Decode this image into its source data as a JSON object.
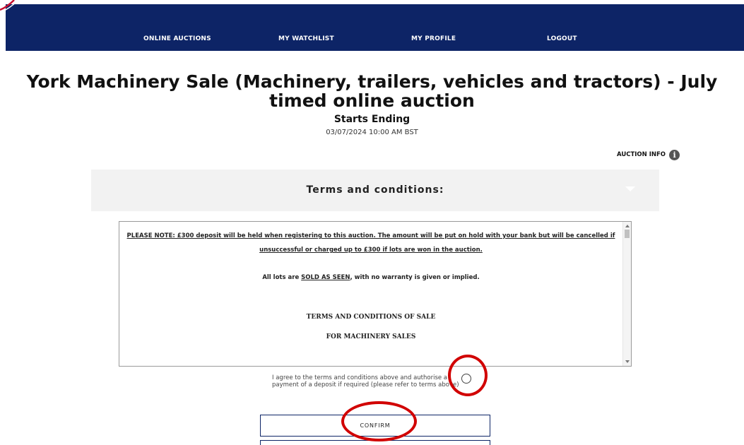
{
  "nav": {
    "items": [
      {
        "label": "ONLINE AUCTIONS"
      },
      {
        "label": "MY WATCHLIST"
      },
      {
        "label": "MY PROFILE"
      },
      {
        "label": "LOGOUT"
      }
    ]
  },
  "auction": {
    "title": "York Machinery Sale (Machinery, trailers, vehicles and tractors) - July timed online auction",
    "status": "Starts Ending",
    "date": "03/07/2024 10:00 AM BST",
    "info_label": "AUCTION INFO",
    "info_icon": "info-icon"
  },
  "terms": {
    "heading": "Terms and conditions:",
    "note": "PLEASE NOTE: £300 deposit will be held when registering to this auction. The amount will be put on hold with your bank but will be cancelled if unsuccessful or charged up to £300 if lots are won in the auction.",
    "sold_prefix": "All lots are ",
    "sold_emphasis": "SOLD AS SEEN",
    "sold_suffix": ", with no warranty is given or implied.",
    "tc_title": "TERMS AND CONDITIONS OF SALE",
    "tc_subtitle": "FOR MACHINERY SALES"
  },
  "agree": {
    "text": "I agree to the terms and conditions above and authorise a payment of a deposit if required (please refer to terms above)",
    "checked": false
  },
  "buttons": {
    "confirm": "CONFIRM"
  },
  "colors": {
    "nav_bg": "#0d2466",
    "annotation": "#d10000",
    "panel_bg": "#f2f2f2"
  }
}
